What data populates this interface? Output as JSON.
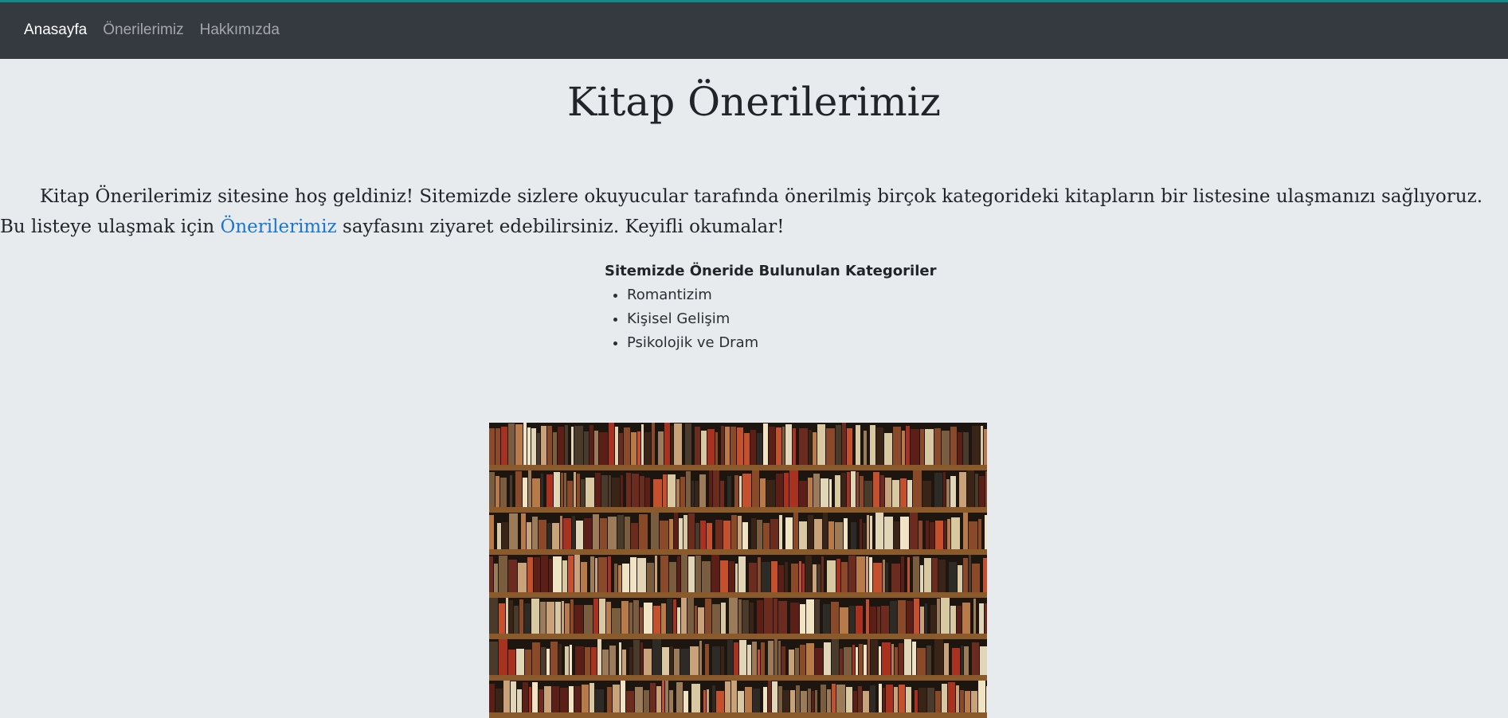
{
  "nav": {
    "items": [
      {
        "label": "Anasayfa",
        "active": true
      },
      {
        "label": "Önerilerimiz",
        "active": false
      },
      {
        "label": "Hakkımızda",
        "active": false
      }
    ]
  },
  "page": {
    "title": "Kitap Önerilerimiz",
    "intro_before": "Kitap Önerilerimiz sitesine hoş geldiniz! Sitemizde sizlere okuyucular tarafında önerilmiş birçok kategorideki kitapların bir listesine ulaşmanızı sağlıyoruz. Bu listeye ulaşmak için ",
    "intro_link": "Önerilerimiz",
    "intro_after": " sayfasını ziyaret edebilirsiniz. Keyifli okumalar!"
  },
  "categories": {
    "heading": "Sitemizde Öneride Bulunulan Kategoriler",
    "items": [
      "Romantizim",
      "Kişisel Gelişim",
      "Psikolojik ve Dram"
    ]
  },
  "colors": {
    "navbar_bg": "#343a40",
    "accent_top": "#138a8a",
    "link": "#1b76d2",
    "page_bg": "#e8ebee"
  },
  "image": {
    "subject": "bookshelf-photo"
  }
}
